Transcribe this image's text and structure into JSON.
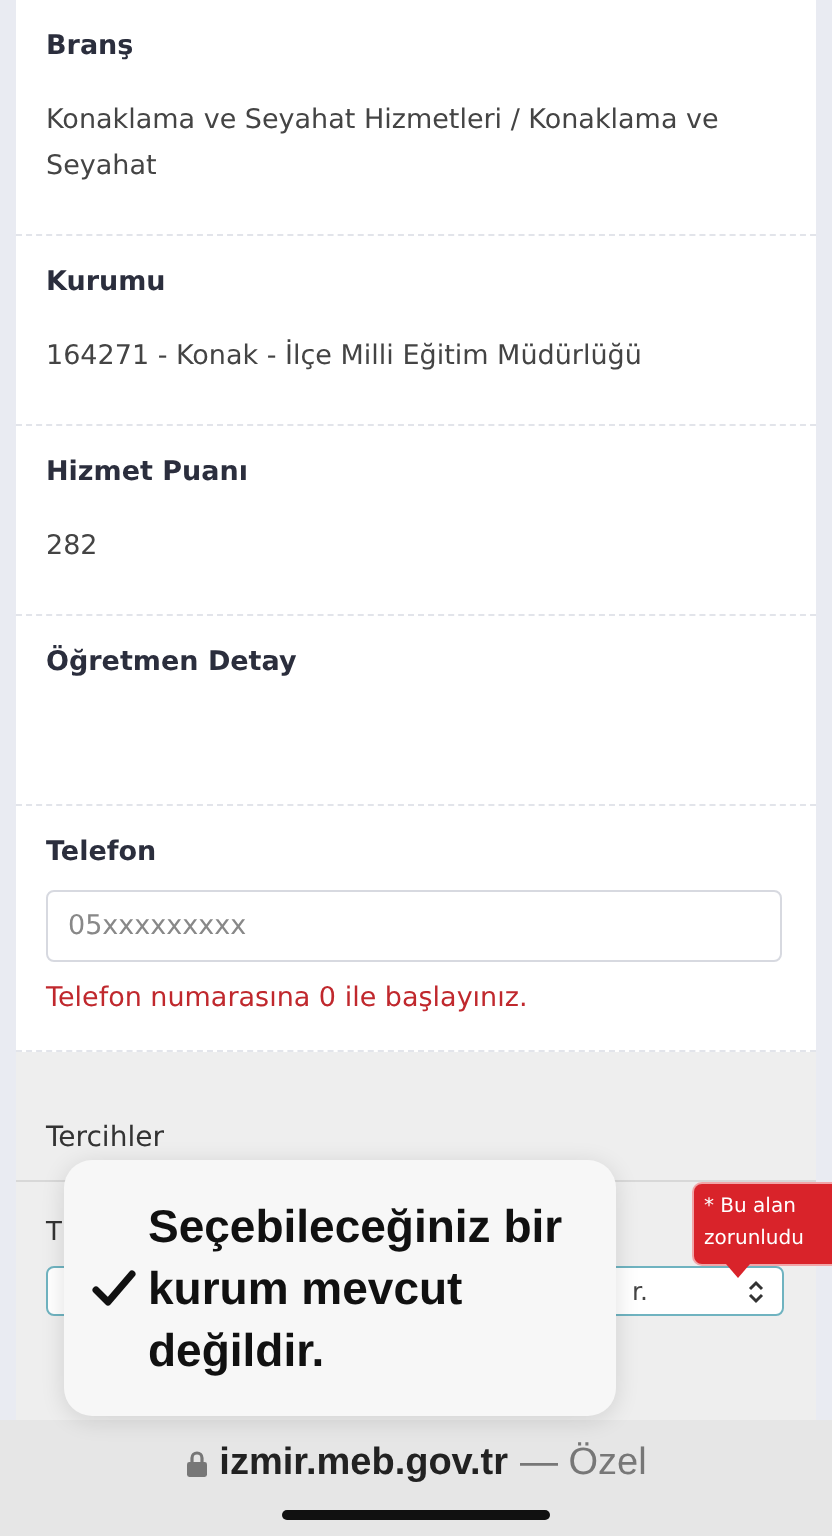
{
  "details": [
    {
      "label": "Branş",
      "value": "Konaklama ve Seyahat Hizmetleri / Konaklama ve Seyahat"
    },
    {
      "label": "Kurumu",
      "value": "164271 - Konak - İlçe Milli Eğitim Müdürlüğü"
    },
    {
      "label": "Hizmet Puanı",
      "value": "282"
    },
    {
      "label": "Öğretmen Detay"
    }
  ],
  "phone": {
    "label": "Telefon",
    "placeholder": "05xxxxxxxxx",
    "error": "Telefon numarasına 0 ile başlayınız."
  },
  "preferences": {
    "title": "Tercihler",
    "field_label": "T",
    "select_value": "r."
  },
  "tooltip": {
    "lines": [
      "* Bu alan",
      "zorunludu"
    ]
  },
  "popup": {
    "checked": true,
    "text": "Seçebileceğiniz bir kurum mevcut değildir."
  },
  "browser": {
    "domain": "izmir.meb.gov.tr",
    "suffix": "— Özel"
  }
}
